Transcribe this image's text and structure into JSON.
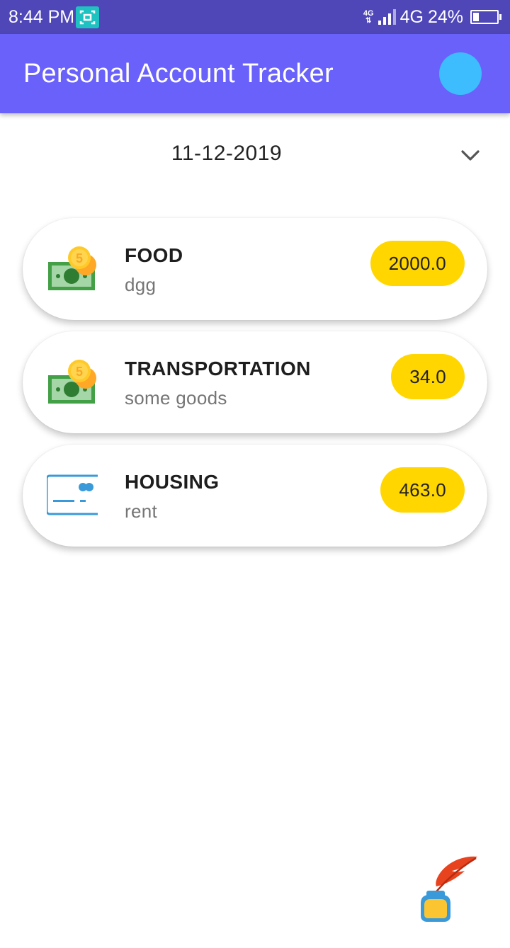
{
  "status_bar": {
    "time": "8:44 PM",
    "network_small": "4G",
    "network": "4G",
    "battery": "24%",
    "battery_level": 0.24
  },
  "header": {
    "title": "Personal Account Tracker"
  },
  "date_selector": {
    "value": "11-12-2019"
  },
  "expenses": [
    {
      "category": "FOOD",
      "note": "dgg",
      "amount": "2000.0",
      "icon": "money-coins-icon"
    },
    {
      "category": "TRANSPORTATION",
      "note": "some goods",
      "amount": "34.0",
      "icon": "money-coins-icon"
    },
    {
      "category": "HOUSING",
      "note": "rent",
      "amount": "463.0",
      "icon": "credit-card-icon"
    }
  ],
  "colors": {
    "status_bar": "#4f47b8",
    "app_bar": "#6a61fb",
    "avatar": "#3dbdfe",
    "amount_badge": "#ffd600"
  }
}
